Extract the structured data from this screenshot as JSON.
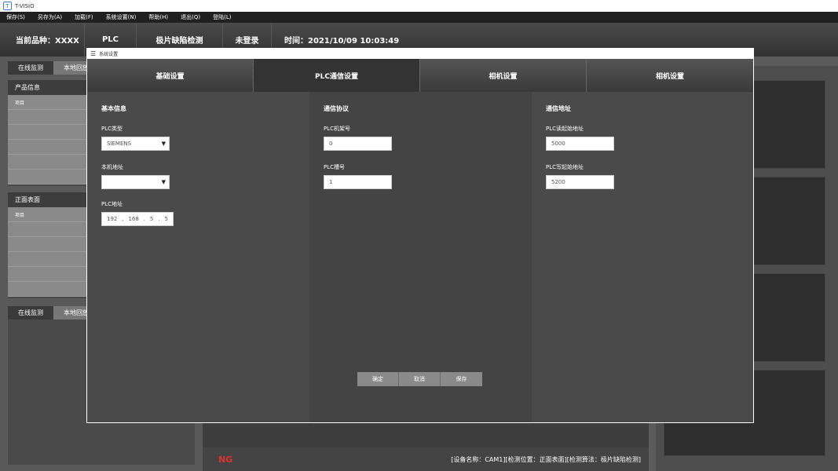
{
  "window": {
    "title": "T-VISIO"
  },
  "menu": [
    "保存(S)",
    "另存为(A)",
    "加载(F)",
    "系统设置(N)",
    "帮助(H)",
    "退出(Q)",
    "登陆(L)"
  ],
  "header": {
    "product": "当前品种：XXXX",
    "plc": "PLC",
    "detect": "极片缺陷检测",
    "login": "未登录",
    "time": "时间：2021/10/09 10:03:49"
  },
  "left": {
    "tabs_top": [
      "在线监测",
      "本地回放"
    ],
    "product_section": {
      "title": "产品信息",
      "first_item": "项目"
    },
    "surface_section": {
      "title": "正面表面",
      "first_item": "项目"
    },
    "tabs_bottom": [
      "在线监测",
      "本地回放"
    ]
  },
  "status": {
    "ng": "NG",
    "device": "[设备名称：CAM1][检测位置：正面表面][检测算法：极片缺陷检测]"
  },
  "dialog": {
    "title": "系统设置",
    "tabs": [
      "基础设置",
      "PLC通信设置",
      "相机设置",
      "相机设置"
    ],
    "active_tab": 1,
    "basic": {
      "title": "基本信息",
      "plc_type_label": "PLC类型",
      "plc_type_value": "SIEMENS",
      "local_addr_label": "本机地址",
      "local_addr_value": "",
      "plc_addr_label": "PLC地址",
      "plc_ip": [
        "192",
        "168",
        "5",
        "5"
      ]
    },
    "protocol": {
      "title": "通信协议",
      "rack_label": "PLC机架号",
      "rack_value": "0",
      "slot_label": "PLC槽号",
      "slot_value": "1"
    },
    "address": {
      "title": "通信地址",
      "read_label": "PLC读起始地址",
      "read_value": "5000",
      "write_label": "PLC写起始地址",
      "write_value": "5200"
    },
    "buttons": {
      "ok": "确定",
      "cancel": "取消",
      "save": "保存"
    }
  },
  "colors": {
    "ng": "#e03030",
    "background": "#5b5b5b",
    "panel": "#4a4a4a"
  }
}
